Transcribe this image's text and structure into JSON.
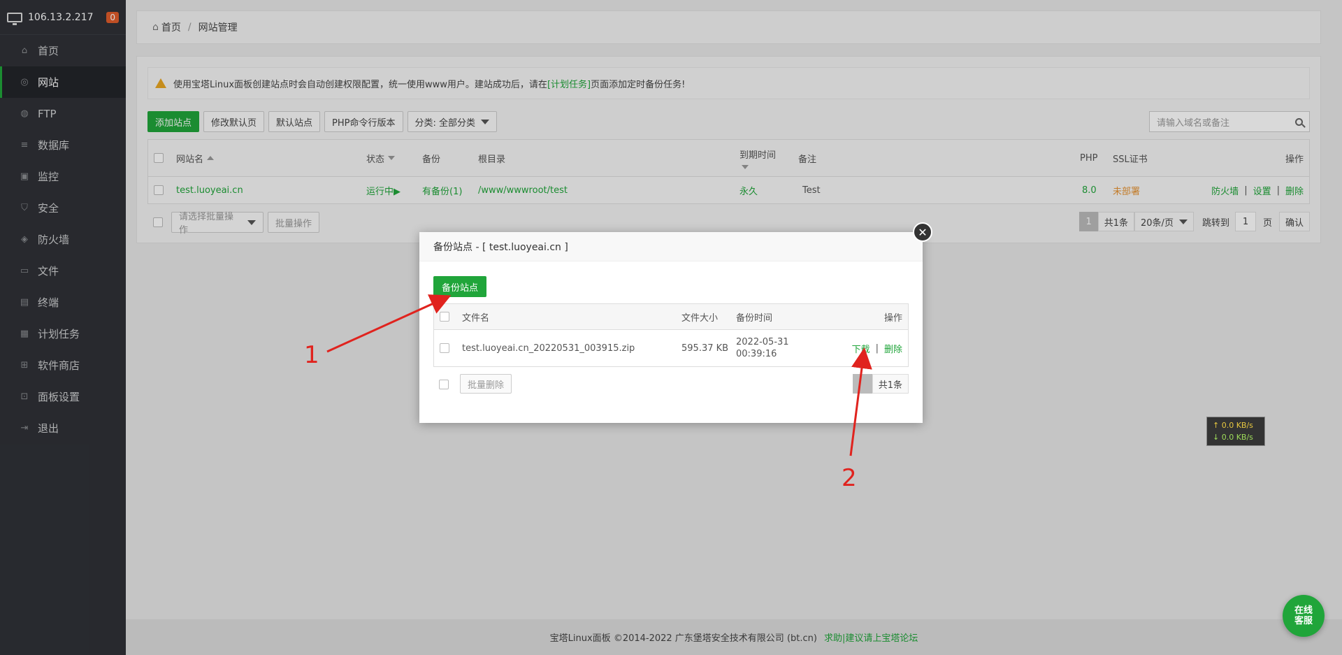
{
  "sidebar": {
    "ip": "106.13.2.217",
    "badge": "0",
    "items": [
      {
        "label": "首页",
        "icon": "home-icon"
      },
      {
        "label": "网站",
        "icon": "globe-icon"
      },
      {
        "label": "FTP",
        "icon": "ftp-icon"
      },
      {
        "label": "数据库",
        "icon": "database-icon"
      },
      {
        "label": "监控",
        "icon": "monitor-icon"
      },
      {
        "label": "安全",
        "icon": "shield-icon"
      },
      {
        "label": "防火墙",
        "icon": "firewall-icon"
      },
      {
        "label": "文件",
        "icon": "folder-icon"
      },
      {
        "label": "终端",
        "icon": "terminal-icon"
      },
      {
        "label": "计划任务",
        "icon": "calendar-icon"
      },
      {
        "label": "软件商店",
        "icon": "apps-icon"
      },
      {
        "label": "面板设置",
        "icon": "settings-icon"
      },
      {
        "label": "退出",
        "icon": "logout-icon"
      }
    ]
  },
  "breadcrumb": {
    "home": "首页",
    "sep": "/",
    "current": "网站管理"
  },
  "notice": {
    "pre": "使用宝塔Linux面板创建站点时会自动创建权限配置，统一使用www用户。建站成功后，请在",
    "link": "[计划任务]",
    "post": "页面添加定时备份任务!"
  },
  "toolbar": {
    "add": "添加站点",
    "edit_default": "修改默认页",
    "default_site": "默认站点",
    "php_cli": "PHP命令行版本",
    "category": "分类: 全部分类"
  },
  "search": {
    "placeholder": "请输入域名或备注"
  },
  "table": {
    "headers": {
      "name": "网站名",
      "status": "状态",
      "backup": "备份",
      "root": "根目录",
      "expire": "到期时间",
      "note": "备注",
      "php": "PHP",
      "ssl": "SSL证书",
      "ops": "操作"
    },
    "row": {
      "name": "test.luoyeai.cn",
      "status": "运行中▶",
      "backup": "有备份(1)",
      "root": "/www/wwwroot/test",
      "expire": "永久",
      "note": "Test",
      "php": "8.0",
      "ssl": "未部署",
      "op_firewall": "防火墙",
      "op_settings": "设置",
      "op_delete": "删除",
      "op_sep": "|"
    }
  },
  "batch": {
    "select_placeholder": "请选择批量操作",
    "btn": "批量操作"
  },
  "pager": {
    "current": "1",
    "total": "共1条",
    "per_page": "20条/页",
    "goto": "跳转到",
    "page_input": "1",
    "page_unit": "页",
    "confirm": "确认"
  },
  "modal": {
    "title": "备份站点 - [ test.luoyeai.cn ]",
    "backup_btn": "备份站点",
    "headers": {
      "filename": "文件名",
      "size": "文件大小",
      "time": "备份时间",
      "ops": "操作"
    },
    "row": {
      "filename": "test.luoyeai.cn_20220531_003915.zip",
      "size": "595.37 KB",
      "time_date": "2022-05-31",
      "time_clock": "00:39:16",
      "download": "下载",
      "sep": "|",
      "delete": "删除"
    },
    "batch_delete": "批量删除",
    "total": "共1条"
  },
  "speed": {
    "up": "↑ 0.0 KB/s",
    "down": "↓ 0.0 KB/s"
  },
  "chat": {
    "line1": "在线",
    "line2": "客服"
  },
  "footer": {
    "copyright": "宝塔Linux面板 ©2014-2022 广东堡塔安全技术有限公司 (bt.cn)",
    "link": "求助|建议请上宝塔论坛"
  },
  "annotations": {
    "one": "1",
    "two": "2"
  },
  "colors": {
    "accent": "#20a53a",
    "warning": "#e69232",
    "sidebar_bg": "#2f3137",
    "arrow": "#e0231e"
  }
}
